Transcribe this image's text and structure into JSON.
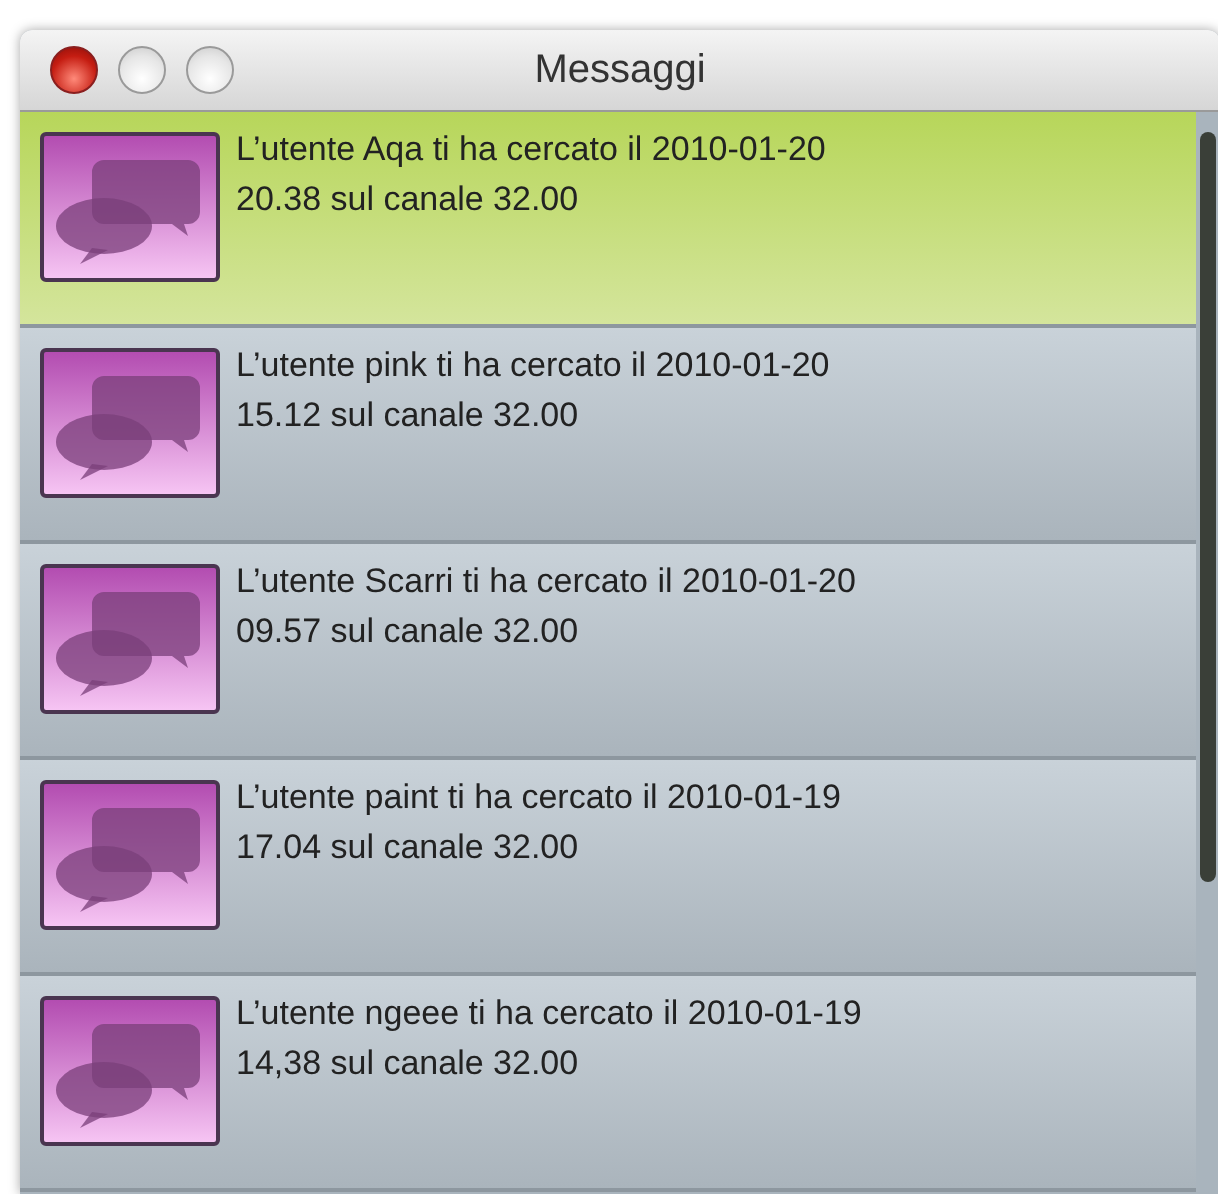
{
  "window": {
    "title": "Messaggi"
  },
  "messages": [
    {
      "text": "L’utente Aqa ti ha cercato il 2010-01-20\n20.38 sul canale 32.00",
      "selected": true
    },
    {
      "text": "L’utente pink ti ha cercato il 2010-01-20\n15.12 sul canale 32.00",
      "selected": false
    },
    {
      "text": "L’utente Scarri ti ha cercato il 2010-01-20\n09.57 sul canale 32.00",
      "selected": false
    },
    {
      "text": "L’utente paint ti ha cercato il 2010-01-19\n17.04 sul canale 32.00",
      "selected": false
    },
    {
      "text": "L’utente ngeee ti ha cercato il 2010-01-19\n14,38 sul canale 32.00",
      "selected": false
    }
  ]
}
